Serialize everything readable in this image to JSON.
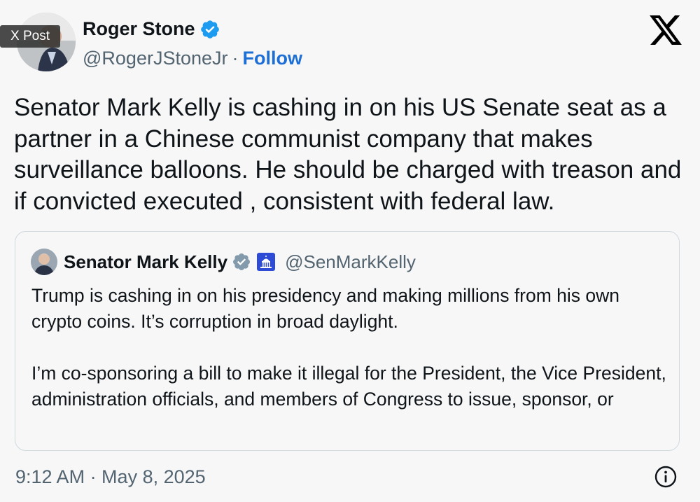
{
  "overlay": {
    "label": "X Post"
  },
  "author": {
    "display_name": "Roger Stone",
    "handle": "@RogerJStoneJr",
    "separator": "·",
    "follow_label": "Follow",
    "verified_color": "#1d9bf0"
  },
  "tweet": {
    "text": "Senator Mark Kelly is cashing in on his US Senate seat as a partner in a Chinese communist company that makes surveillance balloons. He should be charged with treason and if convicted executed , consistent with federal law."
  },
  "quoted": {
    "display_name": "Senator Mark Kelly",
    "handle": "@SenMarkKelly",
    "verified_color": "#829aab",
    "affiliation_icon": "us-capitol-icon",
    "paragraphs": [
      "Trump is cashing in on his presidency and making millions from his own crypto coins. It’s corruption in broad daylight.",
      "I’m co-sponsoring a bill to make it illegal for the President, the Vice President, administration officials, and members of Congress to issue, sponsor, or"
    ]
  },
  "footer": {
    "timestamp": "9:12 AM · May 8, 2025",
    "info_icon": "info-icon"
  },
  "brand": {
    "logo": "x-logo-icon",
    "accent": "#1d6fd6"
  }
}
